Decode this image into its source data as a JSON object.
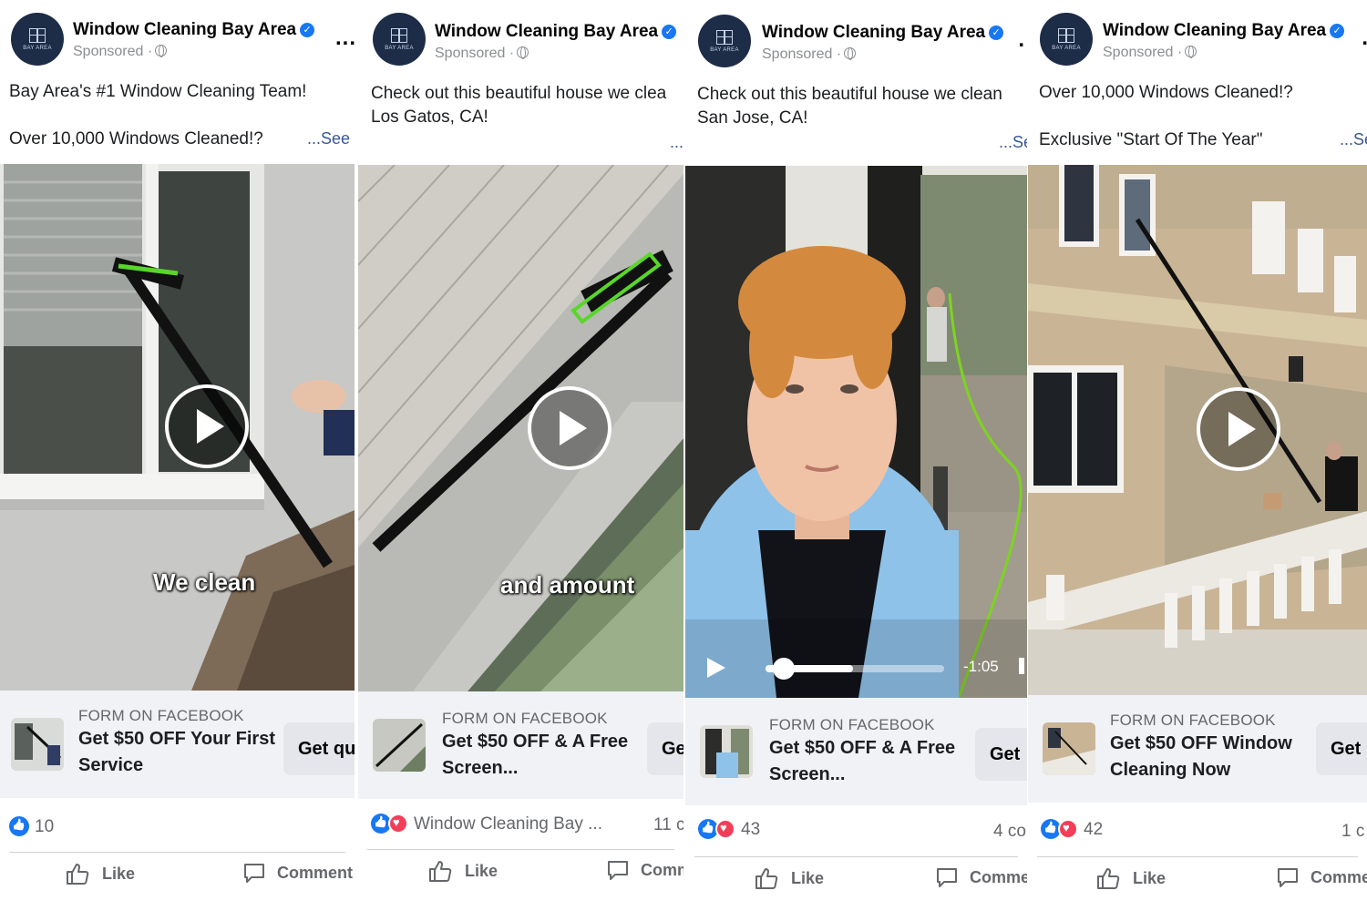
{
  "posts": [
    {
      "page_name": "Window Cleaning Bay Area",
      "sponsored": "Sponsored ·",
      "avatar_text": "BAY AREA",
      "more": "...",
      "caption_line1": "Bay Area's #1 Window Cleaning Team!",
      "caption_line2": "Over 10,000 Windows Cleaned!?",
      "see_more": "...See",
      "video_overlay": "We clean",
      "form_label": "FORM ON FACEBOOK",
      "offer": "Get $50 OFF Your First Service",
      "cta_button": "Get qu",
      "reaction_count": "10",
      "comments": "",
      "like_label": "Like",
      "comment_label": "Comment"
    },
    {
      "page_name": "Window Cleaning Bay Area",
      "sponsored": "Sponsored ·",
      "avatar_text": "BAY AREA",
      "caption_line1": "Check out this beautiful house we clea",
      "caption_line2": "Los Gatos, CA!",
      "see_more": "...",
      "video_overlay": "and amount",
      "form_label": "FORM ON FACEBOOK",
      "offer": "Get $50 OFF & A Free Screen...",
      "cta_button": "Ge",
      "reaction_text": "Window Cleaning Bay ...",
      "comments": "11 c",
      "like_label": "Like",
      "comment_label": "Comm"
    },
    {
      "page_name": "Window Cleaning Bay Area",
      "sponsored": "Sponsored ·",
      "avatar_text": "BAY AREA",
      "more": ".",
      "caption_line1": "Check out this beautiful house we clean",
      "caption_line2": "San Jose, CA!",
      "see_more": "...Se",
      "video_time": "-1:05",
      "video_progress": 0.05,
      "form_label": "FORM ON FACEBOOK",
      "offer": "Get $50 OFF & A Free Screen...",
      "cta_button": "Get",
      "reaction_count": "43",
      "comments": "4 co",
      "like_label": "Like",
      "comment_label": "Comme"
    },
    {
      "page_name": "Window Cleaning Bay Area",
      "sponsored": "Sponsored ·",
      "avatar_text": "BAY AREA",
      "more": ".",
      "caption_line1": "Over 10,000 Windows Cleaned!?",
      "caption_line2": "Exclusive \"Start Of The Year\"",
      "see_more": "...Se",
      "form_label": "FORM ON FACEBOOK",
      "offer": "Get $50 OFF Window Cleaning Now",
      "cta_button": "Get",
      "reaction_count": "42",
      "comments": "1 c",
      "like_label": "Like",
      "comment_label": "Comme"
    }
  ],
  "colors": {
    "brand_blue": "#1877f2",
    "love_red": "#f33e58",
    "avatar_navy": "#1d2c47",
    "cta_bg": "#f0f2f5"
  },
  "icons": [
    "verified-badge-icon",
    "globe-icon",
    "more-icon",
    "play-icon",
    "like-reaction-icon",
    "love-reaction-icon",
    "thumbs-up-icon",
    "comment-icon"
  ]
}
